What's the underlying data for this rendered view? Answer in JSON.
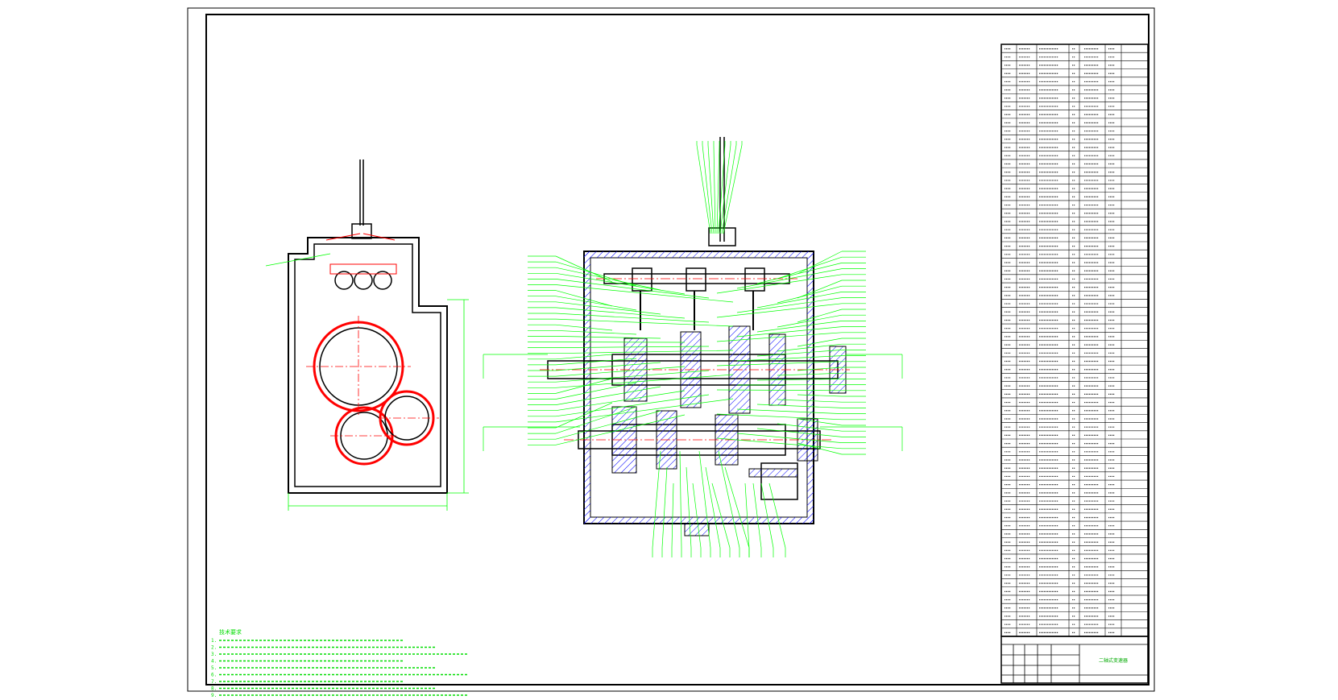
{
  "drawing": {
    "colors": {
      "paper": "#ffffff",
      "outline": "#000000",
      "section": "#ff0000",
      "leader": "#00ff00",
      "hatch": "#0000ff",
      "note": "#00dd00"
    },
    "notes": {
      "heading": "技术要求",
      "lines": [
        "1.",
        "2.",
        "3.",
        "4.",
        "5.",
        "6.",
        "7.",
        "8.",
        "9."
      ]
    },
    "bom_rows": 72,
    "title_block": {
      "name": "二轴式变速器"
    }
  }
}
